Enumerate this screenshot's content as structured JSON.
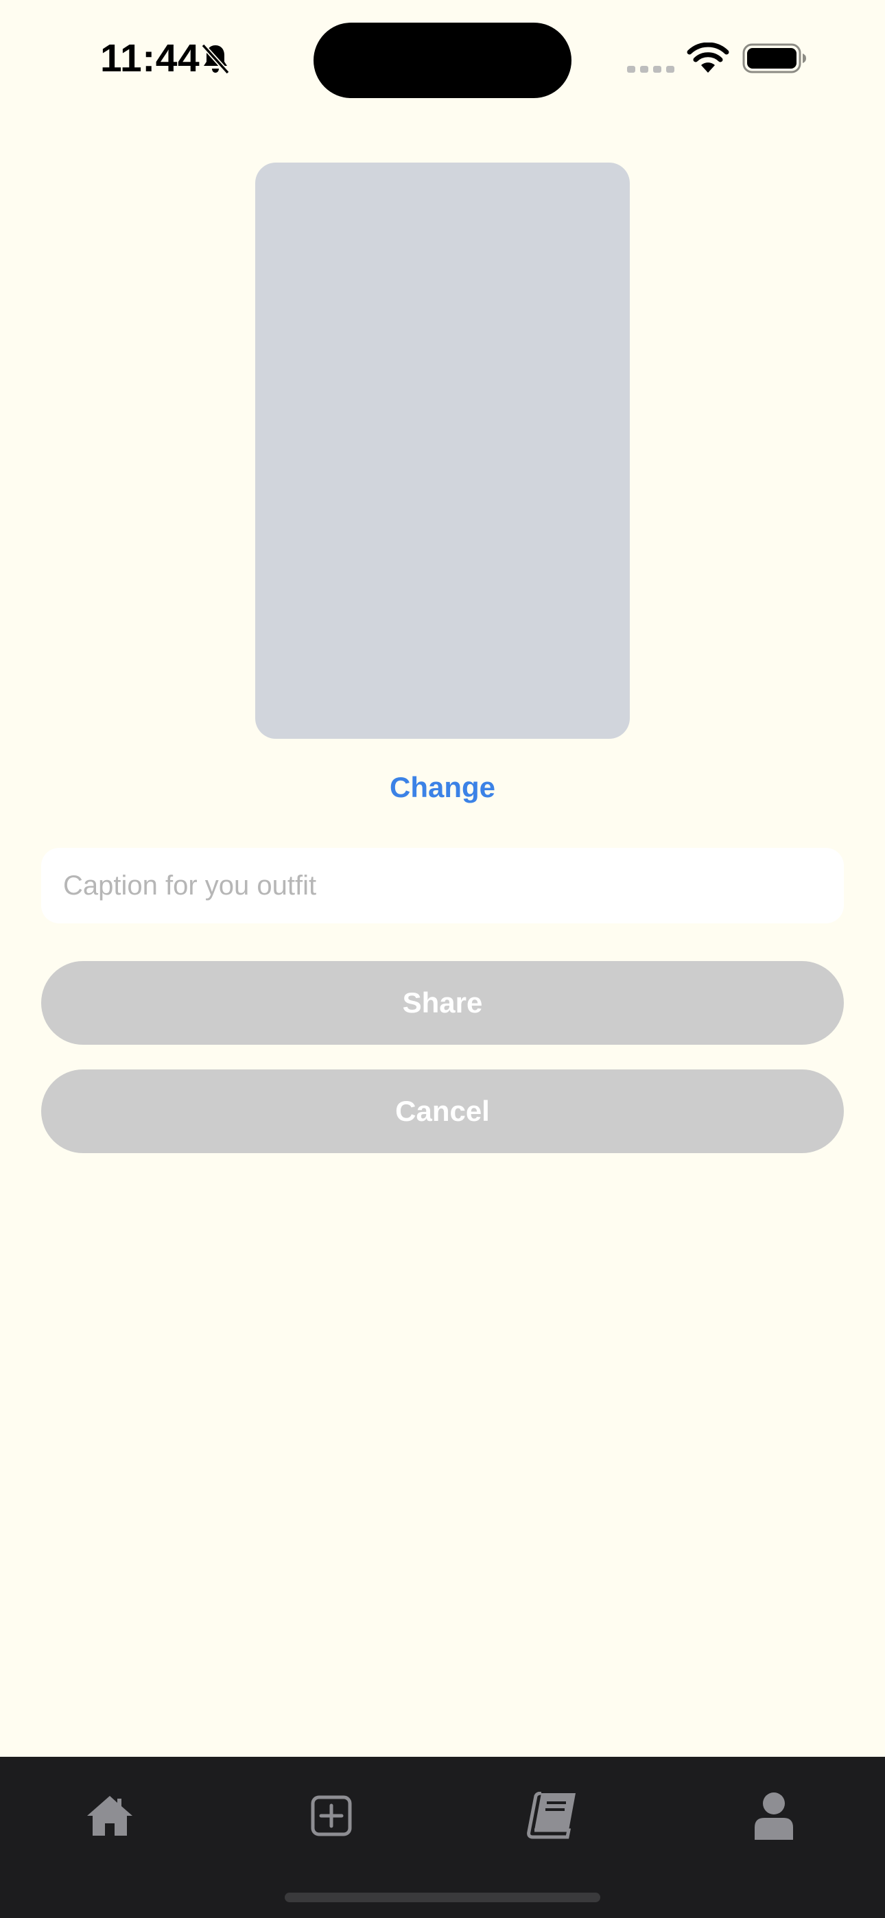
{
  "status_bar": {
    "time": "11:44",
    "icons": [
      "bell-slash-icon",
      "cellular-signal-icon",
      "wifi-icon",
      "battery-icon"
    ]
  },
  "photo": {
    "placeholder_color": "#D1D5DC"
  },
  "change_label": "Change",
  "caption": {
    "value": "",
    "placeholder": "Caption for you outfit"
  },
  "share_label": "Share",
  "cancel_label": "Cancel",
  "tab_bar": {
    "items": [
      {
        "icon": "home-icon"
      },
      {
        "icon": "plus-square-icon"
      },
      {
        "icon": "book-icon"
      },
      {
        "icon": "user-icon"
      }
    ]
  },
  "colors": {
    "background": "#FFFDF1",
    "accent": "#3B82E6",
    "button_disabled": "#CCCCCC",
    "tab_bar": "#1C1C1E",
    "tab_icon": "#8E8E93"
  }
}
